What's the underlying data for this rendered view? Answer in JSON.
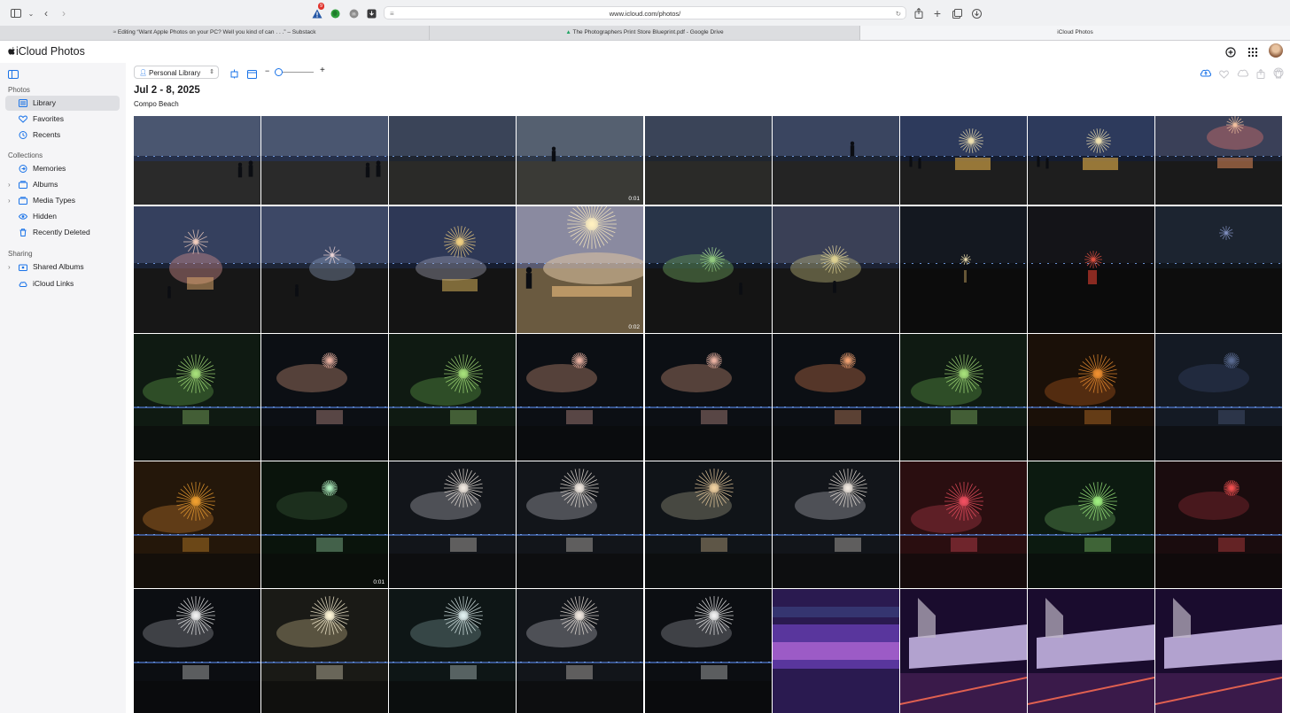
{
  "browser": {
    "url": "www.icloud.com/photos/",
    "notification_count": "9",
    "tabs": [
      {
        "title": "Editing “Want Apple Photos on your PC? Well you kind of can . . .” – Substack",
        "state": "inactive"
      },
      {
        "title": "The Photographers Print Store Blueprint.pdf - Google Drive",
        "state": "inactive"
      },
      {
        "title": "iCloud Photos",
        "state": "active"
      }
    ]
  },
  "app": {
    "title": "iCloud Photos"
  },
  "sidebar": {
    "photos_header": "Photos",
    "photos_items": [
      {
        "label": "Library",
        "icon": "library-icon",
        "selected": true
      },
      {
        "label": "Favorites",
        "icon": "heart-icon"
      },
      {
        "label": "Recents",
        "icon": "clock-icon"
      }
    ],
    "collections_header": "Collections",
    "collections_items": [
      {
        "label": "Memories",
        "icon": "memories-icon"
      },
      {
        "label": "Albums",
        "icon": "albums-icon",
        "expandable": true
      },
      {
        "label": "Media Types",
        "icon": "media-types-icon",
        "expandable": true
      },
      {
        "label": "Hidden",
        "icon": "eye-icon"
      },
      {
        "label": "Recently Deleted",
        "icon": "trash-icon"
      }
    ],
    "sharing_header": "Sharing",
    "sharing_items": [
      {
        "label": "Shared Albums",
        "icon": "shared-albums-icon",
        "expandable": true
      },
      {
        "label": "iCloud Links",
        "icon": "cloud-link-icon"
      }
    ]
  },
  "toolbar": {
    "library_selector": "Personal Library",
    "zoom_fraction": 0.1
  },
  "section": {
    "date": "Jul 2 - 8, 2025",
    "location": "Compo Beach"
  },
  "photos": [
    [
      {
        "scene": "dusk-people"
      },
      {
        "scene": "dusk-people"
      },
      {
        "scene": "dusk"
      },
      {
        "scene": "dusk-walker",
        "duration": "0:01"
      },
      {
        "scene": "dusk"
      },
      {
        "scene": "dusk-person"
      },
      {
        "scene": "firework-early"
      },
      {
        "scene": "firework-early"
      },
      {
        "scene": "firework-pink"
      }
    ],
    [
      {
        "scene": "smoke-pink"
      },
      {
        "scene": "smoke-blue"
      },
      {
        "scene": "firework-gold-dusk"
      },
      {
        "scene": "firework-bright",
        "duration": "0:02"
      },
      {
        "scene": "firework-green-dusk"
      },
      {
        "scene": "firework-yellow-dusk"
      },
      {
        "scene": "dark-small"
      },
      {
        "scene": "dark-red"
      },
      {
        "scene": "dark-blue-small"
      }
    ],
    [
      {
        "scene": "green-burst"
      },
      {
        "scene": "small-burst"
      },
      {
        "scene": "green-burst"
      },
      {
        "scene": "small-burst"
      },
      {
        "scene": "small-burst"
      },
      {
        "scene": "small-burst-orange"
      },
      {
        "scene": "green-burst"
      },
      {
        "scene": "orange-burst"
      },
      {
        "scene": "dark-blue-burst"
      }
    ],
    [
      {
        "scene": "orange-big"
      },
      {
        "scene": "green-dark",
        "duration": "0:01"
      },
      {
        "scene": "white-smoke"
      },
      {
        "scene": "white-smoke"
      },
      {
        "scene": "gold-smoke"
      },
      {
        "scene": "white-smoke"
      },
      {
        "scene": "red-big"
      },
      {
        "scene": "green-big"
      },
      {
        "scene": "red-dark"
      }
    ],
    [
      {
        "scene": "white-dark"
      },
      {
        "scene": "white-bright"
      },
      {
        "scene": "white-teal"
      },
      {
        "scene": "white-smoke"
      },
      {
        "scene": "white-dark"
      },
      {
        "scene": "purple-blur"
      },
      {
        "scene": "purple-building"
      },
      {
        "scene": "purple-building"
      },
      {
        "scene": "purple-building"
      }
    ]
  ],
  "colors": {
    "accent": "#1a73e8",
    "sidebar_bg": "#f5f5f7",
    "selected_bg": "#dedfe3"
  }
}
